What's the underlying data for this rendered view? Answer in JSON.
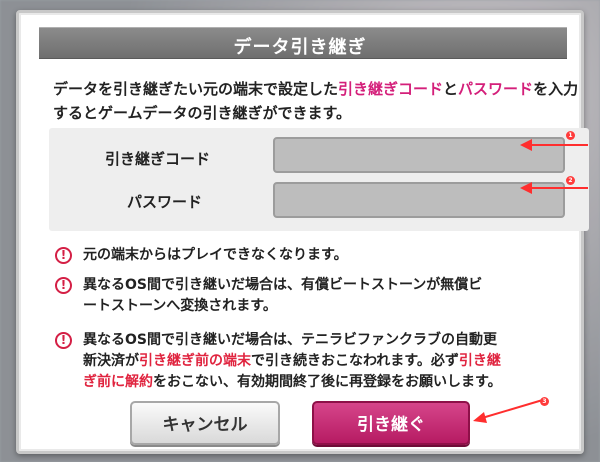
{
  "dialog": {
    "title": "データ引き継ぎ",
    "description": {
      "part1": "データを引き継ぎたい元の端末で設定した",
      "highlight1": "引き継ぎコード",
      "part2": "と",
      "highlight2": "パスワード",
      "part3": "を入力するとゲームデータの引き継ぎができます。"
    },
    "fields": {
      "code_label": "引き継ぎコード",
      "code_value": "",
      "password_label": "パスワード",
      "password_value": ""
    },
    "notes": [
      {
        "text": "元の端末からはプレイできなくなります。"
      },
      {
        "line1": "異なるOS間で引き継いだ場合は、有償ビートストーンが無償ビ",
        "line2": "ートストーンへ変換されます。"
      },
      {
        "line1": "異なるOS間で引き継いだ場合は、テニラビファンクラブの自動更",
        "line2_a": "新決済が",
        "line2_red1": "引き継ぎ前の端末",
        "line2_b": "で引き続きおこなわれます。必ず",
        "line2_red2": "引き継",
        "line3_red": "ぎ前に解約",
        "line3_b": "をおこない、有効期間終了後に再登録をお願いします。"
      }
    ],
    "buttons": {
      "cancel": "キャンセル",
      "confirm": "引き継ぐ"
    },
    "markers": [
      "1",
      "2",
      "3"
    ]
  },
  "colors": {
    "accent": "#d41f7a",
    "warning": "#e0243f",
    "confirm_button": "#c2266f"
  },
  "icons": {
    "warning": "exclamation-circle-icon",
    "arrow": "red-arrow-icon"
  }
}
